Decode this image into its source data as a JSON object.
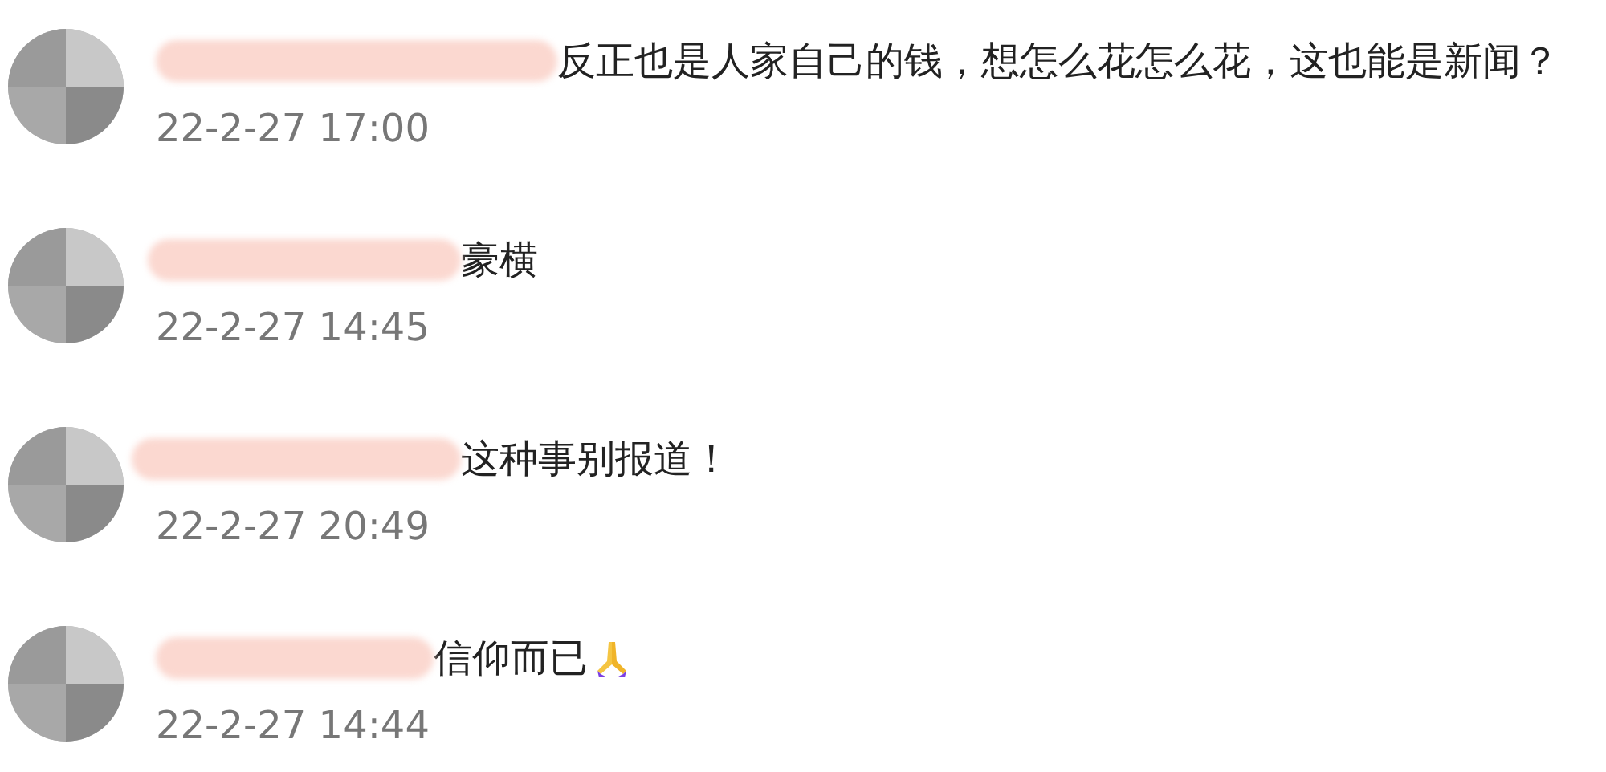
{
  "comments": [
    {
      "text": "反正也是人家自己的钱，想怎么花怎么花，这也能是新闻？",
      "time": "22-2-27 17:00",
      "trailing_emoji": false
    },
    {
      "text": "豪横",
      "time": "22-2-27 14:45",
      "trailing_emoji": false
    },
    {
      "text": "这种事别报道！",
      "time": "22-2-27 20:49",
      "trailing_emoji": false
    },
    {
      "text": "信仰而已",
      "time": "22-2-27 14:44",
      "trailing_emoji": true
    }
  ]
}
